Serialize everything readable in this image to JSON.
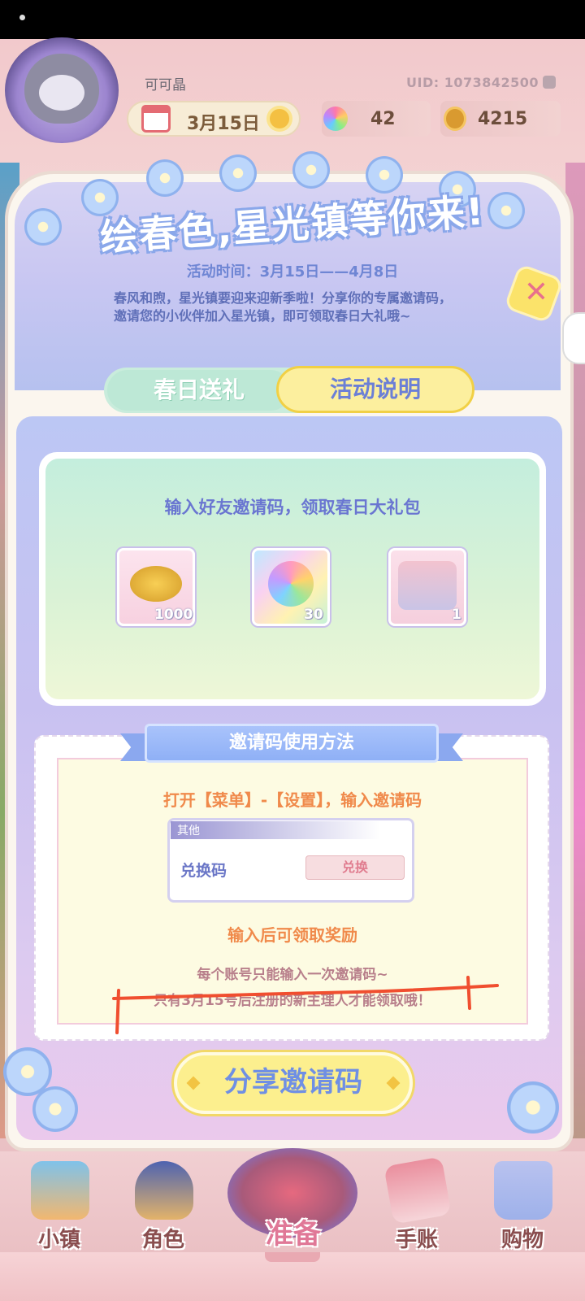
{
  "profile": {
    "name": "可可晶",
    "uid": "UID: 1073842500",
    "date": "3月15日",
    "gems": "42",
    "coins": "4215"
  },
  "event": {
    "title": "绘春色,星光镇等你来!",
    "time": "活动时间：3月15日——4月8日",
    "description": "春风和煦，星光镇要迎来迎新季啦！分享你的专属邀请码，邀请您的小伙伴加入星光镇，即可领取春日大礼哦~",
    "close_icon": "close-icon"
  },
  "tabs": [
    {
      "label": "春日送礼",
      "active": false
    },
    {
      "label": "活动说明",
      "active": true
    }
  ],
  "rewards": {
    "heading": "输入好友邀请码，领取春日大礼包",
    "items": [
      {
        "icon": "gold-coins-icon",
        "count": "1000"
      },
      {
        "icon": "rainbow-gem-icon",
        "count": "30"
      },
      {
        "icon": "makeup-kit-icon",
        "count": "1"
      }
    ]
  },
  "howto": {
    "title": "邀请码使用方法",
    "step": "打开【菜单】-【设置】，输入邀请码",
    "mock": {
      "header": "其他",
      "label": "兑换码",
      "button": "兑换"
    },
    "after": "输入后可领取奖励",
    "note1": "每个账号只能输入一次邀请码~",
    "note2": "只有3月15号后注册的新主理人才能领取哦！"
  },
  "share_button": "分享邀请码",
  "nav": [
    {
      "label": "小镇",
      "icon": "map-icon"
    },
    {
      "label": "角色",
      "icon": "character-icon"
    },
    {
      "label": "准备",
      "icon": "dresser-icon"
    },
    {
      "label": "手账",
      "icon": "journal-icon"
    },
    {
      "label": "购物",
      "icon": "shopping-bag-icon"
    }
  ],
  "colors": {
    "title_outline": "#8aa7ea",
    "active_tab": "#fcef9e",
    "step_text": "#f08a4b",
    "annotation_mark": "#f04e2f"
  }
}
